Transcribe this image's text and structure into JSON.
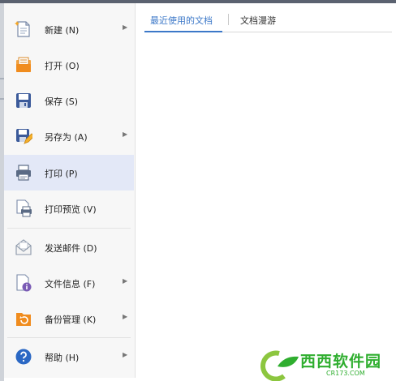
{
  "menu": {
    "items": [
      {
        "label": "新建 (N)",
        "icon": "new-document-icon",
        "has_submenu": true
      },
      {
        "label": "打开 (O)",
        "icon": "open-folder-icon",
        "has_submenu": false
      },
      {
        "label": "保存 (S)",
        "icon": "save-icon",
        "has_submenu": false
      },
      {
        "label": "另存为 (A)",
        "icon": "save-as-icon",
        "has_submenu": true
      },
      {
        "label": "打印 (P)",
        "icon": "printer-icon",
        "has_submenu": false,
        "selected": true
      },
      {
        "label": "打印预览 (V)",
        "icon": "print-preview-icon",
        "has_submenu": false
      },
      {
        "label": "发送邮件 (D)",
        "icon": "send-mail-icon",
        "has_submenu": false
      },
      {
        "label": "文件信息 (F)",
        "icon": "file-info-icon",
        "has_submenu": true
      },
      {
        "label": "备份管理 (K)",
        "icon": "backup-icon",
        "has_submenu": true
      },
      {
        "label": "帮助 (H)",
        "icon": "help-icon",
        "has_submenu": true
      }
    ],
    "submenu_arrow": "▶"
  },
  "tabs": {
    "recent": "最近使用的文档",
    "roaming": "文档漫游",
    "active": "recent"
  },
  "watermark": {
    "brand": "西西软件园",
    "site": "CR173.COM"
  },
  "colors": {
    "accent": "#3c78c8",
    "selected_bg": "#e3e8f7",
    "menu_bg": "#f7f7f7",
    "watermark": "#2fae2f"
  }
}
